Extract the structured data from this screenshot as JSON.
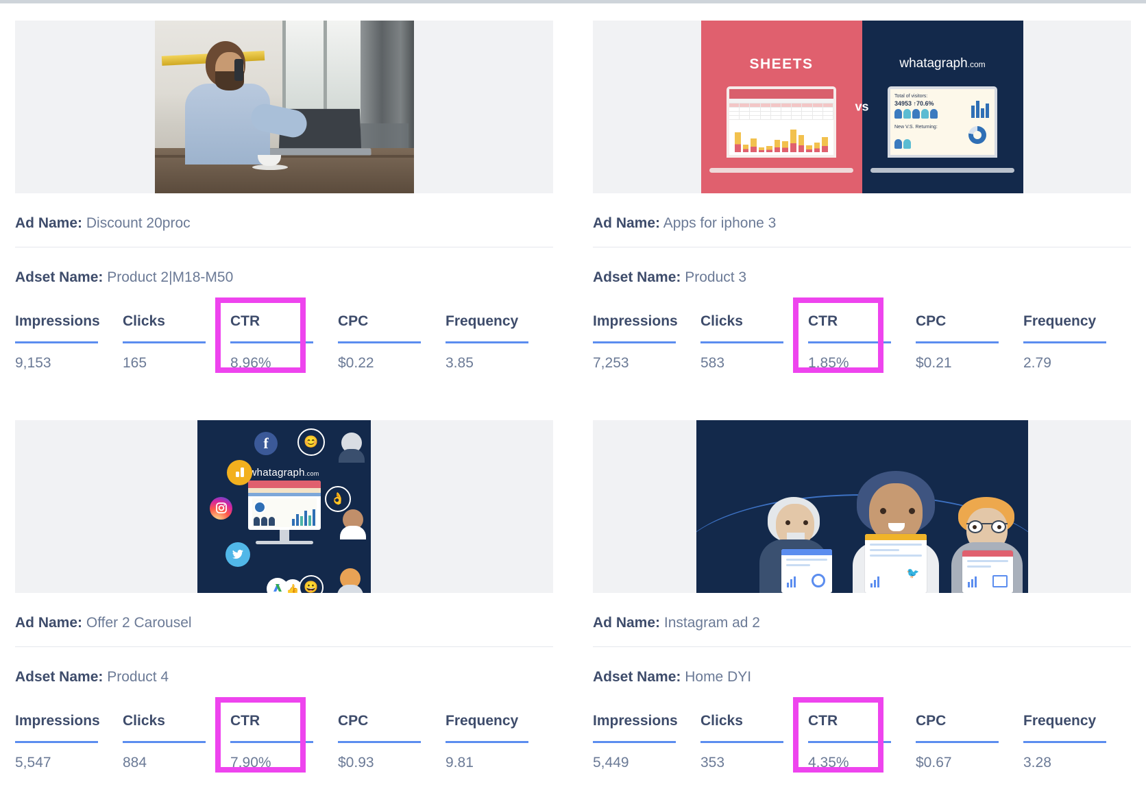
{
  "accent": {
    "highlight": "#ee44ee",
    "underline": "#5b8def",
    "label": "#3e4c6b",
    "value": "#6b7a96"
  },
  "labels": {
    "ad_name": "Ad Name:",
    "adset_name": "Adset Name:"
  },
  "metric_columns": [
    "Impressions",
    "Clicks",
    "CTR",
    "CPC",
    "Frequency"
  ],
  "highlighted_metric": "CTR",
  "cards": [
    {
      "ad_name": "Discount 20proc",
      "adset_name": "Product 2|M18-M50",
      "image_name": "ad-creative-man-at-desk-photo",
      "metrics": {
        "Impressions": "9,153",
        "Clicks": "165",
        "CTR": "8.96%",
        "CPC": "$0.22",
        "Frequency": "3.85"
      }
    },
    {
      "ad_name": "Apps for iphone 3",
      "adset_name": "Product 3",
      "image_name": "ad-creative-sheets-vs-whatagraph",
      "image_text": {
        "left_title": "SHEETS",
        "vs": "vs",
        "right_title": "whatagraph",
        "right_title_suffix": ".com",
        "dash_line1": "Total of visitors:",
        "dash_line2": "34953  ↑70.6%",
        "dash_line3": "New V.S. Returning:"
      },
      "metrics": {
        "Impressions": "7,253",
        "Clicks": "583",
        "CTR": "1.85%",
        "CPC": "$0.21",
        "Frequency": "2.79"
      }
    },
    {
      "ad_name": "Offer 2 Carousel",
      "adset_name": "Product 4",
      "image_name": "ad-creative-social-carousel",
      "image_text": {
        "brand": "whatagraph",
        "brand_suffix": ".com"
      },
      "metrics": {
        "Impressions": "5,547",
        "Clicks": "884",
        "CTR": "7.90%",
        "CPC": "$0.93",
        "Frequency": "9.81"
      }
    },
    {
      "ad_name": "Instagram ad 2",
      "adset_name": "Home DYI",
      "image_name": "ad-creative-three-people-reports",
      "metrics": {
        "Impressions": "5,449",
        "Clicks": "353",
        "CTR": "4.35%",
        "CPC": "$0.67",
        "Frequency": "3.28"
      }
    }
  ]
}
